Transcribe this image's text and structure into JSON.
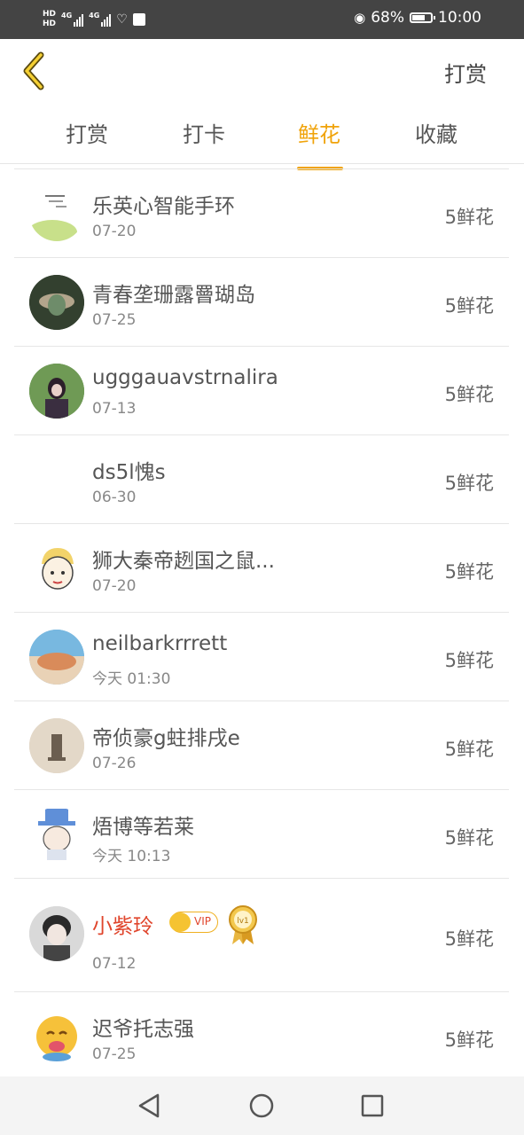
{
  "status_bar": {
    "hd1": "HD",
    "hd2": "HD",
    "net1": "4G",
    "net2": "4G",
    "battery": "68%",
    "time": "10:00"
  },
  "header": {
    "action_label": "打赏"
  },
  "tabs": [
    {
      "label": "打赏",
      "active": false
    },
    {
      "label": "打卡",
      "active": false
    },
    {
      "label": "鲜花",
      "active": true
    },
    {
      "label": "收藏",
      "active": false
    }
  ],
  "list": [
    {
      "name": "乐英心智能手环",
      "date": "07-20",
      "amount": "5鲜花",
      "avatar": "avatar-1"
    },
    {
      "name": "青春垄珊露罾瑚岛",
      "date": "07-25",
      "amount": "5鲜花",
      "avatar": "avatar-2"
    },
    {
      "name": "ugggauavstrnalira",
      "date": "07-13",
      "amount": "5鲜花",
      "avatar": "avatar-3"
    },
    {
      "name": "ds5l愧s",
      "date": "06-30",
      "amount": "5鲜花",
      "avatar": "none"
    },
    {
      "name": "狮大秦帝趔国之鼠...",
      "date": "07-20",
      "amount": "5鲜花",
      "avatar": "avatar-5"
    },
    {
      "name": "neilbarkrrrett",
      "date": "今天 01:30",
      "amount": "5鲜花",
      "avatar": "avatar-6"
    },
    {
      "name": "帝侦豪g蛀排戌e",
      "date": "07-26",
      "amount": "5鲜花",
      "avatar": "avatar-7"
    },
    {
      "name": "焐博等若莱",
      "date": "今天 10:13",
      "amount": "5鲜花",
      "avatar": "avatar-8"
    },
    {
      "name": "小紫玲",
      "date": "07-12",
      "amount": "5鲜花",
      "avatar": "avatar-9",
      "vip": "VIP",
      "level": "lv1"
    },
    {
      "name": "迟爷托志强",
      "date": "07-25",
      "amount": "5鲜花",
      "avatar": "avatar-10"
    }
  ],
  "colors": {
    "accent": "#f0a30a",
    "vip_name": "#e0452c",
    "status_bar_bg": "#444444"
  }
}
